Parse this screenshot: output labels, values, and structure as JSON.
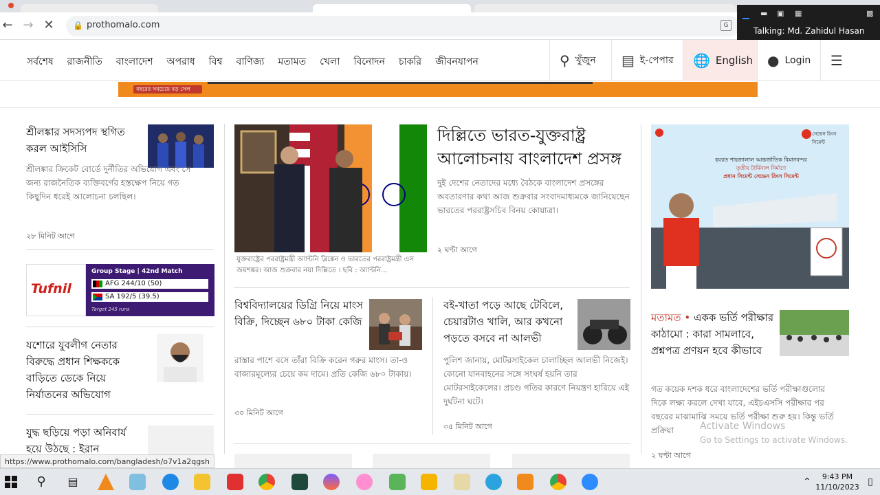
{
  "browser": {
    "url": "prothomalo.com",
    "status_url": "https://www.prothomalo.com/bangladesh/o7v1a2qgsh"
  },
  "zoom": {
    "talking": "Talking: Md. Zahidul Hasan"
  },
  "nav": {
    "items": [
      "সর্বশেষ",
      "রাজনীতি",
      "বাংলাদেশ",
      "অপরাধ",
      "বিশ্ব",
      "বাণিজ্য",
      "মতামত",
      "খেলা",
      "বিনোদন",
      "চাকরি",
      "জীবনযাপন"
    ],
    "search_label": "খুঁজুন",
    "epaper_label": "ই-পেপার",
    "lang_label": "English",
    "login_label": "Login"
  },
  "ad": {
    "tag_text": "বছরের সবচেয়ে বড় সেল"
  },
  "left": {
    "s1_title": "শ্রীলঙ্কার সদস্যপদ স্থগিত করল আইসিসি",
    "s1_body": "শ্রীলঙ্কার ক্রিকেট বোর্ডে দুর্নীতির অভিযোগ এবং সে জন্য রাজনৈতিক ব্যক্তিবর্গের হস্তক্ষেপ নিয়ে গত কিছুদিন ধরেই আলোচনা চলছিল।",
    "s1_time": "২৮ মিনিট আগে",
    "s2_title": "যশোরে যুবলীগ নেতার বিরুদ্ধে প্রধান শিক্ষককে বাড়িতে ডেকে নিয়ে নির্যাতনের অভিযোগ",
    "s3_title": "যুদ্ধ ছড়িয়ে পড়া অনিবার্য হয়ে উঠছে : ইরান"
  },
  "cricket": {
    "brand": "Tufnil",
    "stage": "Group Stage | 42nd Match",
    "team1": "AFG 244/10 (50)",
    "team2": "SA 192/5 (39.5)",
    "target": "Target 245 runs"
  },
  "lead": {
    "title": "দিল্লিতে ভারত-যুক্তরাষ্ট্র আলোচনায় বাংলাদেশ প্রসঙ্গ",
    "body": "দুই দেশের নেতাদের মধ্যে বৈঠকে বাংলাদেশ প্রসঙ্গের অবতারণার কথা আজ শুক্রবার সংবাদমাধ্যমকে জানিয়েছেন ভারতের পররাষ্ট্রসচিব বিনয় কোয়াত্রা।",
    "time": "২ ঘণ্টা আগে",
    "caption": "যুক্তরাষ্ট্রের পররাষ্ট্রমন্ত্রী অ্যান্টনি ব্লিঙ্কেন ও ভারতের পররাষ্ট্রমন্ত্রী এস জয়শঙ্কর। আজ শুক্রবার নয়া দিল্লিতে । ছবি : অ্যান্টনি..."
  },
  "mid1": {
    "title": "বিশ্ববিদ্যালয়ের ডিগ্রি নিয়ে মাংস বিক্রি, দিচ্ছেন ৬৮০ টাকা কেজি",
    "body": "রাস্তার পাশে বসে তাঁরা বিক্রি করেন গরুর মাংস। তা-ও বাজারমূল্যের চেয়ে কম দামে। প্রতি কেজি ৬৮০ টাকায়।",
    "time": "৩০ মিনিট আগে"
  },
  "mid2": {
    "title": "বই-খাতা পড়ে আছে টেবিলে, চেয়ারটাও খালি, আর কখনো পড়তে বসবে না আলভী",
    "body": "পুলিশ জানায়, মোটরসাইকেল চালাচ্ছিল আলভী নিজেই। কোনো যানবাহনের সঙ্গে সংঘর্ষ হয়নি তার মোটরসাইকেলের। প্রচণ্ড গতির কারণে নিয়ন্ত্রণ হারিয়ে এই দুর্ঘটনা ঘটে।",
    "time": "৩৫ মিনিট আগে"
  },
  "right": {
    "ad_line1": "হযরত শাহজালাল আন্তর্জাতিক বিমানবন্দর",
    "ad_line2": "তৃতীয় টার্মিনাল নির্মাণে",
    "ad_line3": "প্রধান সিমেন্ট সেভেন রিংস সিমেন্ট",
    "ad_brand": "সেভেন রিংস সিমেন্ট",
    "op_tag": "মতামত",
    "op_title": "একক ভর্তি পরীক্ষার কাঠামো : কারা সামলাবে, প্রশ্নপত্র প্রণয়ন হবে কীভাবে",
    "op_body": "গত কয়েক দশক ধরে বাংলাদেশের ভর্তি পরীক্ষাগুলোর দিকে লক্ষ্য করলে দেখা যাবে, এইচএসসি পরীক্ষার পর বছরের মাঝামাঝি সময়ে ভর্তি পরীক্ষা শুরু হয়। কিন্তু ভর্তি প্রক্রিয়া",
    "op_time": "২ ঘণ্টা আগে"
  },
  "windows": {
    "activate": "Activate Windows",
    "activate_sub": "Go to Settings to activate Windows.",
    "time": "9:43 PM",
    "date": "11/10/2023"
  }
}
